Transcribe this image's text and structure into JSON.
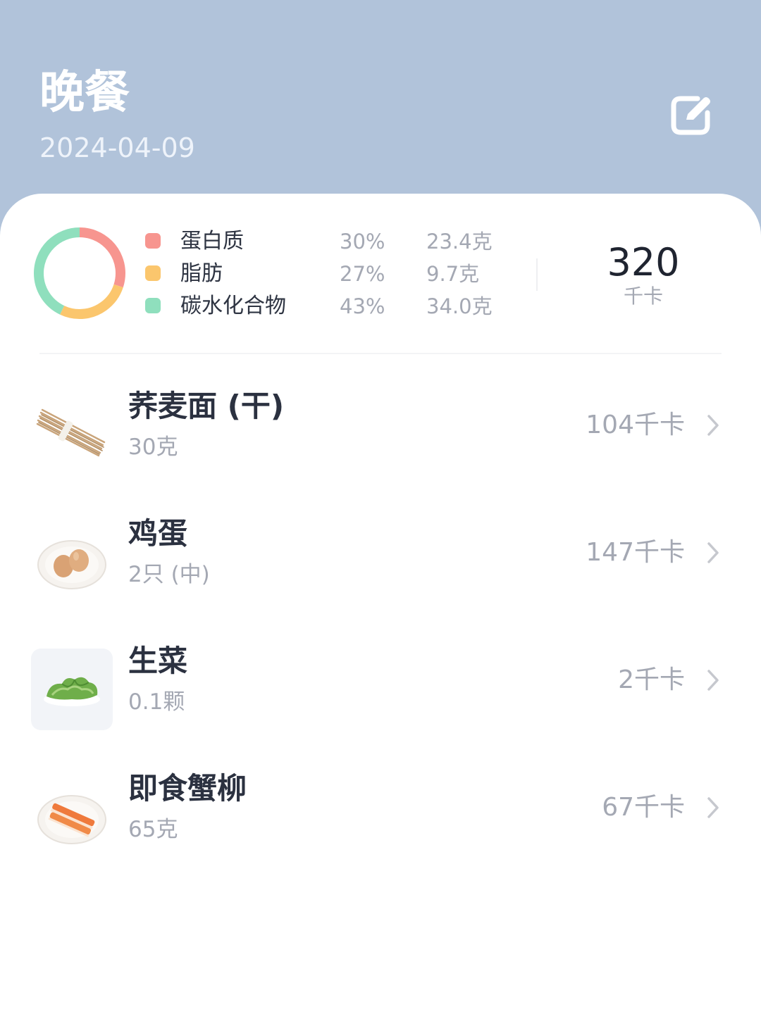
{
  "header": {
    "title": "晚餐",
    "date": "2024-04-09",
    "edit_icon": "edit-icon"
  },
  "summary": {
    "total_kcal": "320",
    "total_unit": "千卡",
    "macros": [
      {
        "name": "蛋白质",
        "percent": "30%",
        "amount": "23.4克",
        "color": "#f7958f",
        "fraction": 0.3
      },
      {
        "name": "脂肪",
        "percent": "27%",
        "amount": "9.7克",
        "color": "#fbc66d",
        "fraction": 0.27
      },
      {
        "name": "碳水化合物",
        "percent": "43%",
        "amount": "34.0克",
        "color": "#8fdfbd",
        "fraction": 0.43
      }
    ]
  },
  "foods": [
    {
      "name": "荞麦面 (干)",
      "qty": "30克",
      "kcal": "104千卡",
      "icon": "noodles-icon"
    },
    {
      "name": "鸡蛋",
      "qty": "2只 (中)",
      "kcal": "147千卡",
      "icon": "eggs-icon"
    },
    {
      "name": "生菜",
      "qty": "0.1颗",
      "kcal": "2千卡",
      "icon": "lettuce-icon"
    },
    {
      "name": "即食蟹柳",
      "qty": "65克",
      "kcal": "67千卡",
      "icon": "crab-stick-icon"
    }
  ],
  "colors": {
    "header_bg": "#b1c3da",
    "card_bg": "#ffffff"
  }
}
